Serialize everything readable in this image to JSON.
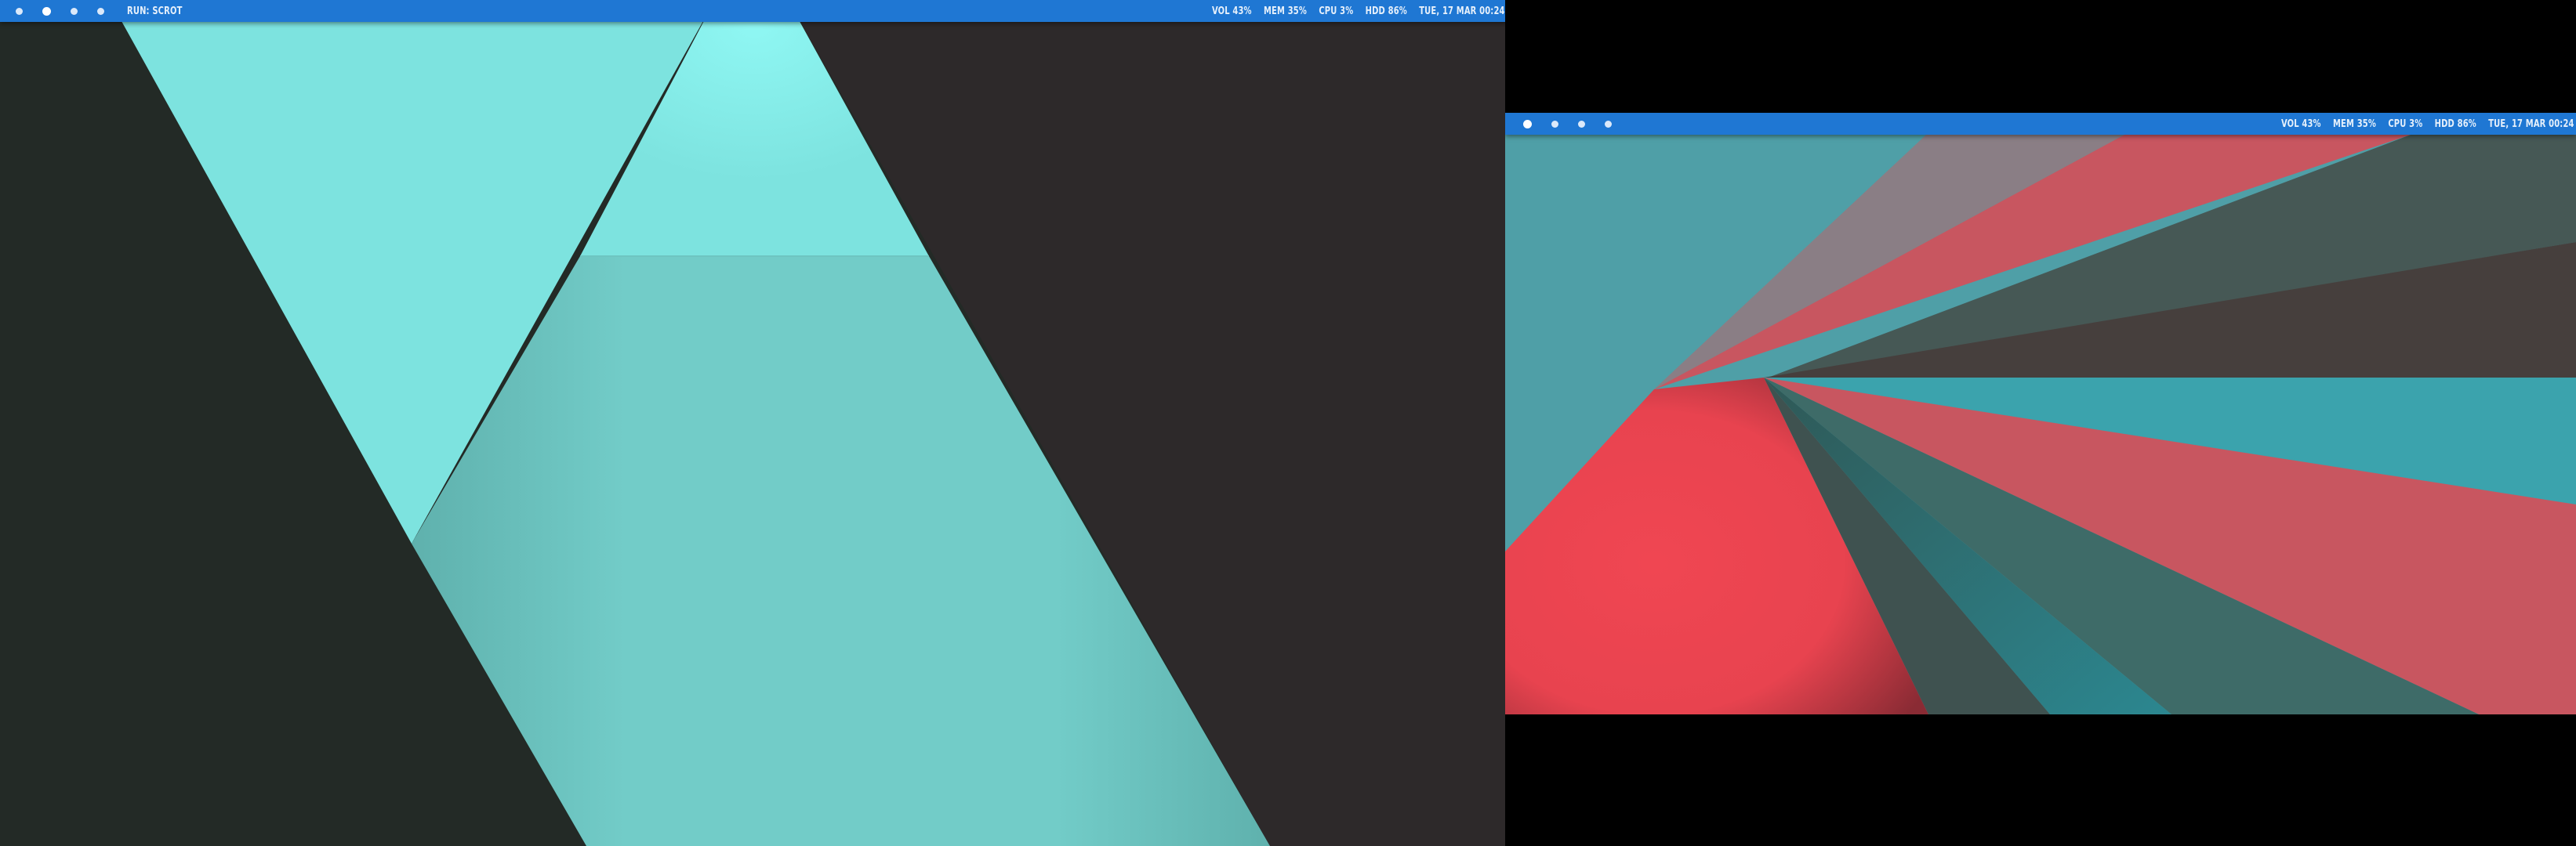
{
  "screens": [
    {
      "id": "left",
      "bar": {
        "workspaces": [
          "1",
          "2",
          "3",
          "4"
        ],
        "active_workspace": 1,
        "run_label": "RUN: SCROT",
        "stats": {
          "volume": "VOL 43%",
          "memory": "MEM 35%",
          "cpu": "CPU 3%",
          "disk": "HDD 86%",
          "clock": "TUE, 17 MAR 00:24"
        }
      },
      "wallpaper": {
        "colors": [
          "#232a26",
          "#2d292a",
          "#7de3df",
          "#72ccc8",
          "#86f3f0"
        ]
      }
    },
    {
      "id": "right",
      "bar": {
        "workspaces": [
          "1",
          "2",
          "3",
          "4"
        ],
        "active_workspace": 0,
        "stats": {
          "volume": "VOL 43%",
          "memory": "MEM 35%",
          "cpu": "CPU 3%",
          "disk": "HDD 86%",
          "clock": "TUE, 17 MAR 00:24"
        }
      },
      "wallpaper": {
        "colors": [
          "#4f9fa7",
          "#8a7e85",
          "#c85660",
          "#465855",
          "#463f3d",
          "#3ba3ad",
          "#ee4651",
          "#3e6b68"
        ]
      }
    }
  ],
  "theme": {
    "bar_color": "#1f77d3",
    "bar_text_color": "#e6f0fb"
  }
}
